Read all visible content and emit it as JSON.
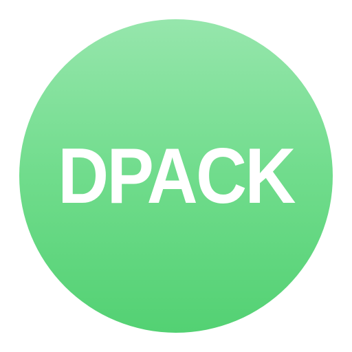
{
  "app_icon": {
    "label": "DPACK",
    "colors": {
      "gradient_top": "#96e6ac",
      "gradient_middle": "#70dc8c",
      "gradient_bottom": "#53d173",
      "text": "#ffffff",
      "background": "#ffffff"
    }
  }
}
